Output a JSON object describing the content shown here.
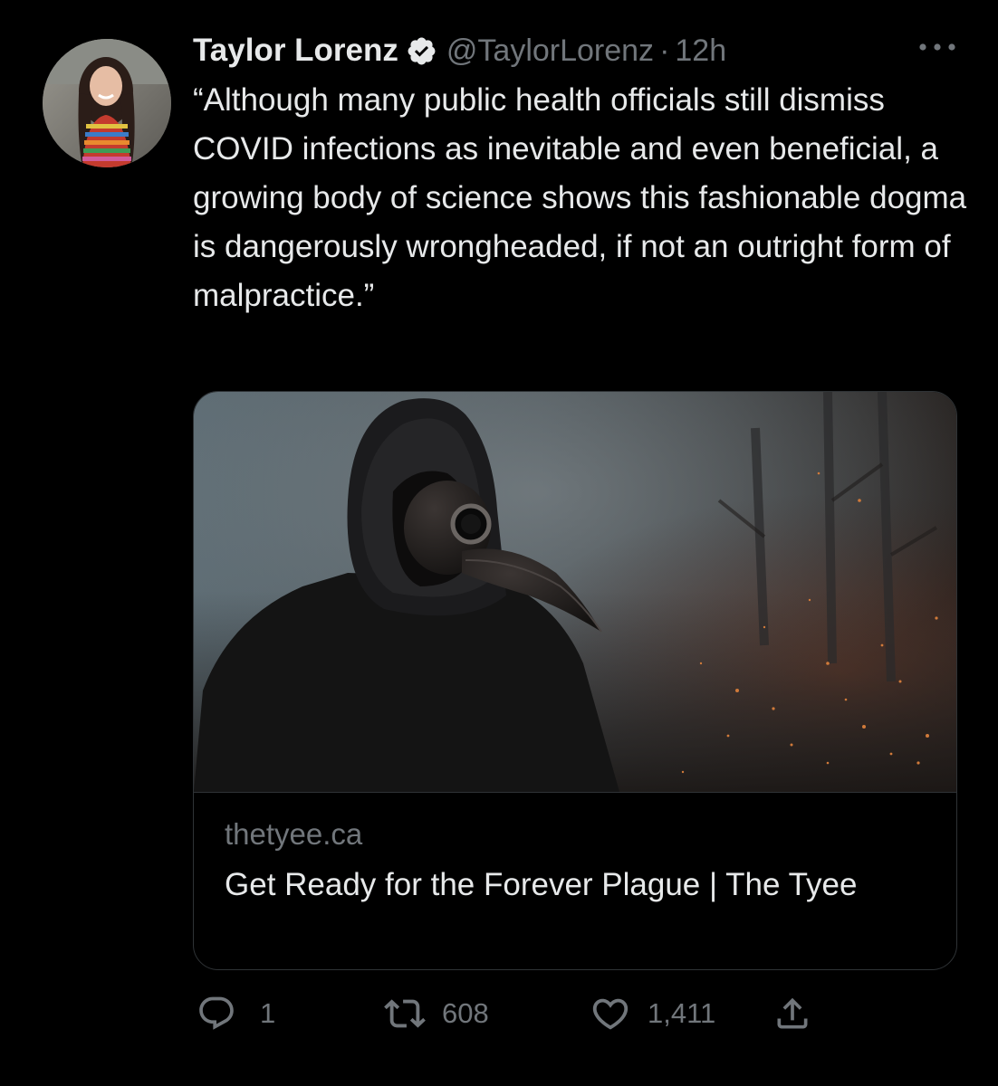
{
  "tweet": {
    "author_name": "Taylor Lorenz",
    "handle": "@TaylorLorenz",
    "separator": "·",
    "timestamp": "12h",
    "text": "“Although many public health officials still dismiss COVID infections as inevitable and even beneficial, a growing body of science shows this fashionable dogma is dangerously wrongheaded, if not an outright form of malpractice.”",
    "icons": {
      "verified": "verified-badge-icon",
      "more": "more-options-icon"
    }
  },
  "card": {
    "domain": "thetyee.ca",
    "title": "Get Ready for the Forever Plague | The Tyee",
    "image": "plague-doctor-mask-photo"
  },
  "actions": {
    "reply": {
      "icon": "reply-icon",
      "count": "1"
    },
    "retweet": {
      "icon": "retweet-icon",
      "count": "608"
    },
    "like": {
      "icon": "heart-icon",
      "count": "1,411"
    },
    "share": {
      "icon": "share-icon"
    }
  },
  "colors": {
    "background": "#000000",
    "text_primary": "#e7e9ea",
    "text_secondary": "#71767b",
    "border": "#2f3336"
  }
}
